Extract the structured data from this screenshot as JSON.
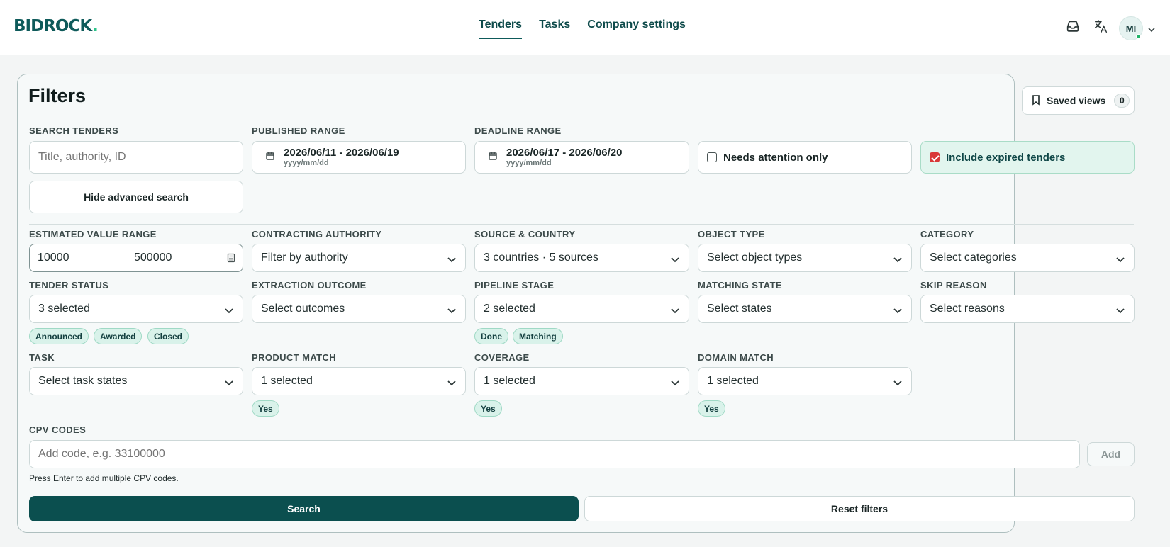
{
  "header": {
    "logo": "BIDROCK",
    "logo_dot": ".",
    "nav": [
      {
        "label": "Tenders",
        "active": true
      },
      {
        "label": "Tasks",
        "active": false
      },
      {
        "label": "Company settings",
        "active": false
      }
    ],
    "icons": [
      "inbox-icon",
      "translate-icon",
      "chevron-down-icon"
    ],
    "avatar_initials": "MI"
  },
  "filters": {
    "title": "Filters",
    "saved_views": {
      "label": "Saved views",
      "count": "0"
    },
    "search": {
      "label": "SEARCH TENDERS",
      "placeholder": "Title, authority, ID"
    },
    "published_range": {
      "label": "PUBLISHED RANGE",
      "value": "2026/06/11 - 2026/06/19",
      "format": "yyyy/mm/dd"
    },
    "deadline_range": {
      "label": "DEADLINE RANGE",
      "value": "2026/06/17 - 2026/06/20",
      "format": "yyyy/mm/dd"
    },
    "needs_attention": {
      "label": "Needs attention only",
      "checked": false
    },
    "include_expired": {
      "label": "Include expired tenders",
      "checked": true
    },
    "hide_advanced": "Hide advanced search",
    "estimated_value": {
      "label": "ESTIMATED VALUE RANGE",
      "min": "10000",
      "max": "500000"
    },
    "contracting_authority": {
      "label": "CONTRACTING AUTHORITY",
      "value": "Filter by authority"
    },
    "source_country": {
      "label": "SOURCE & COUNTRY",
      "value": "3 countries · 5 sources"
    },
    "object_type": {
      "label": "OBJECT TYPE",
      "value": "Select object types"
    },
    "category": {
      "label": "CATEGORY",
      "value": "Select categories"
    },
    "tender_status": {
      "label": "TENDER STATUS",
      "value": "3 selected",
      "chips": [
        "Announced",
        "Awarded",
        "Closed"
      ]
    },
    "extraction_outcome": {
      "label": "EXTRACTION OUTCOME",
      "value": "Select outcomes"
    },
    "pipeline_stage": {
      "label": "PIPELINE STAGE",
      "value": "2 selected",
      "chips": [
        "Done",
        "Matching"
      ]
    },
    "matching_state": {
      "label": "MATCHING STATE",
      "value": "Select states"
    },
    "skip_reason": {
      "label": "SKIP REASON",
      "value": "Select reasons"
    },
    "task": {
      "label": "TASK",
      "value": "Select task states"
    },
    "product_match": {
      "label": "PRODUCT MATCH",
      "value": "1 selected",
      "chips": [
        "Yes"
      ]
    },
    "coverage": {
      "label": "COVERAGE",
      "value": "1 selected",
      "chips": [
        "Yes"
      ]
    },
    "domain_match": {
      "label": "DOMAIN MATCH",
      "value": "1 selected",
      "chips": [
        "Yes"
      ]
    },
    "cpv": {
      "label": "CPV CODES",
      "placeholder": "Add code, e.g. 33100000",
      "add_label": "Add",
      "helper": "Press Enter to add multiple CPV codes."
    },
    "search_button": "Search",
    "reset_button": "Reset filters"
  },
  "colors": {
    "brand": "#0b4f4f",
    "chip_bg": "#d9f2ea",
    "checked": "#d93838",
    "expired_bg": "#e2f5ee"
  }
}
